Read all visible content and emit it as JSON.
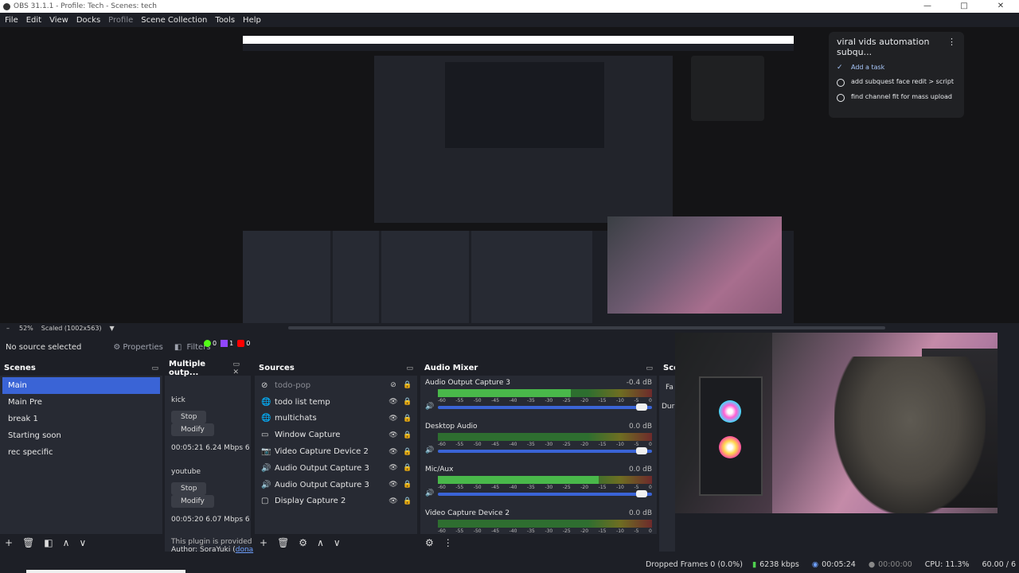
{
  "window": {
    "title": "OBS 31.1.1 - Profile: Tech - Scenes: tech",
    "controls": [
      "—",
      "□",
      "✕"
    ]
  },
  "menu": [
    "File",
    "Edit",
    "View",
    "Docks",
    "Profile",
    "Scene Collection",
    "Tools",
    "Help"
  ],
  "todo_overlay": {
    "title": "viral vids automation subqu...",
    "add_task": "Add a task",
    "tasks": [
      "add subquest face redit > script",
      "find channel fit for mass upload"
    ]
  },
  "scale": {
    "zoom": "52%",
    "mode": "Scaled (1002x563)"
  },
  "source_status": {
    "none_selected": "No source selected",
    "properties": "Properties",
    "filters": "Filters",
    "counts": [
      "0",
      "1",
      "0"
    ]
  },
  "scenes": {
    "title": "Scenes",
    "items": [
      "Main",
      "Main Pre",
      "break 1",
      "Starting soon",
      "rec specific"
    ],
    "selected": "Main"
  },
  "multiple_output": {
    "title": "Multiple outp...",
    "outputs": [
      {
        "name": "kick",
        "stop": "Stop",
        "modify": "Modify",
        "stats": "00:05:21 6.24 Mbps 6"
      },
      {
        "name": "youtube",
        "stop": "Stop",
        "modify": "Modify",
        "stats": "00:05:20 6.07 Mbps 6"
      }
    ],
    "plugin_note": "This plugin is provided",
    "author": "Author: SoraYuki (",
    "author_link": "dona"
  },
  "sources": {
    "title": "Sources",
    "items": [
      {
        "name": "todo-pop",
        "icon": "text-icon",
        "hidden": true
      },
      {
        "name": "todo list temp",
        "icon": "browser-icon"
      },
      {
        "name": "multichats",
        "icon": "browser-icon"
      },
      {
        "name": "Window Capture",
        "icon": "window-icon"
      },
      {
        "name": "Video Capture Device 2",
        "icon": "camera-icon"
      },
      {
        "name": "Audio Output Capture 3",
        "icon": "speaker-icon"
      },
      {
        "name": "Audio Output Capture 3",
        "icon": "speaker-icon"
      },
      {
        "name": "Display Capture 2",
        "icon": "display-icon"
      }
    ]
  },
  "audio_mixer": {
    "title": "Audio Mixer",
    "ticks": [
      "-60",
      "-55",
      "-50",
      "-45",
      "-40",
      "-35",
      "-30",
      "-25",
      "-20",
      "-15",
      "-10",
      "-5",
      "0"
    ],
    "channels": [
      {
        "name": "Audio Output Capture 3",
        "db": "-0.4 dB",
        "level": 0.62
      },
      {
        "name": "Desktop Audio",
        "db": "0.0 dB",
        "level": 0.0
      },
      {
        "name": "Mic/Aux",
        "db": "0.0 dB",
        "level": 0.75
      },
      {
        "name": "Video Capture Device 2",
        "db": "0.0 dB",
        "level": 0.0
      }
    ]
  },
  "scene_transitions_partial": {
    "title": "Sce",
    "label_fa": "Fa",
    "label_dur": "Dur"
  },
  "status_bar": {
    "dropped": "Dropped Frames 0 (0.0%)",
    "bitrate": "6238 kbps",
    "stream_time": "00:05:24",
    "rec_time": "00:00:00",
    "cpu": "CPU: 11.3%",
    "fps": "60.00 / 6"
  }
}
